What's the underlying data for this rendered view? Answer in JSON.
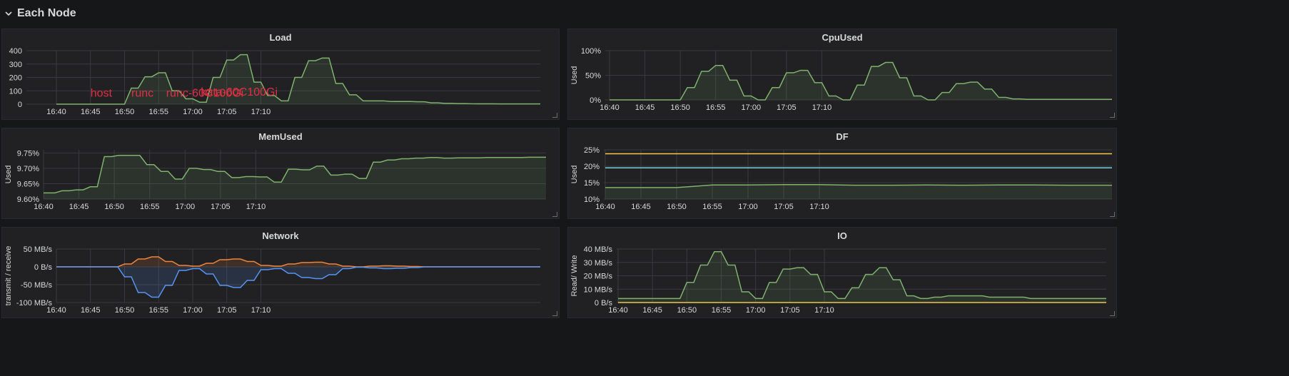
{
  "row": {
    "title": "Each Node"
  },
  "colors": {
    "green": "#7eb26d",
    "green_fill": "rgba(126,178,109,0.12)",
    "orange": "#ef843c",
    "blue": "#5794f2",
    "yellow": "#f2c94c",
    "cyan": "#6ed0e0",
    "annotation": "#e02f44",
    "grid": "#3a3a3e",
    "tick": "#d8d9da"
  },
  "panels": [
    {
      "id": "load",
      "title": "Load",
      "ylabel": "",
      "xticks": [
        "16:40",
        "16:45",
        "16:50",
        "16:55",
        "17:00",
        "17:05",
        "17:10"
      ],
      "yticks": [
        {
          "v": 0,
          "l": "0"
        },
        {
          "v": 100,
          "l": "100"
        },
        {
          "v": 200,
          "l": "200"
        },
        {
          "v": 300,
          "l": "300"
        },
        {
          "v": 400,
          "l": "400"
        }
      ],
      "ylim": [
        0,
        400
      ],
      "annotations": [
        {
          "t": 16.75,
          "v": 55,
          "text": "host"
        },
        {
          "t": 16.85,
          "v": 55,
          "text": "runc"
        },
        {
          "t": 16.935,
          "v": 55,
          "text": "runc-60C100Gi"
        },
        {
          "t": 17.02,
          "v": 65,
          "text": "kata-60C100Gi"
        }
      ]
    },
    {
      "id": "cpu",
      "title": "CpuUsed",
      "ylabel": "Used",
      "xticks": [
        "16:40",
        "16:45",
        "16:50",
        "16:55",
        "17:00",
        "17:05",
        "17:10"
      ],
      "yticks": [
        {
          "v": 0,
          "l": "0%"
        },
        {
          "v": 50,
          "l": "50%"
        },
        {
          "v": 100,
          "l": "100%"
        }
      ],
      "ylim": [
        0,
        100
      ]
    },
    {
      "id": "mem",
      "title": "MemUsed",
      "ylabel": "Used",
      "xticks": [
        "16:40",
        "16:45",
        "16:50",
        "16:55",
        "17:00",
        "17:05",
        "17:10"
      ],
      "yticks": [
        {
          "v": 9.6,
          "l": "9.60%"
        },
        {
          "v": 9.65,
          "l": "9.65%"
        },
        {
          "v": 9.7,
          "l": "9.70%"
        },
        {
          "v": 9.75,
          "l": "9.75%"
        }
      ],
      "ylim": [
        9.6,
        9.76
      ]
    },
    {
      "id": "df",
      "title": "DF",
      "ylabel": "Used",
      "xticks": [
        "16:40",
        "16:45",
        "16:50",
        "16:55",
        "17:00",
        "17:05",
        "17:10"
      ],
      "yticks": [
        {
          "v": 10,
          "l": "10%"
        },
        {
          "v": 15,
          "l": "15%"
        },
        {
          "v": 20,
          "l": "20%"
        },
        {
          "v": 25,
          "l": "25%"
        }
      ],
      "ylim": [
        10,
        25
      ]
    },
    {
      "id": "net",
      "title": "Network",
      "ylabel": "transmit / receive",
      "xticks": [
        "16:40",
        "16:45",
        "16:50",
        "16:55",
        "17:00",
        "17:05",
        "17:10"
      ],
      "yticks": [
        {
          "v": -100,
          "l": "-100 MB/s"
        },
        {
          "v": -50,
          "l": "-50 MB/s"
        },
        {
          "v": 0,
          "l": "0 B/s"
        },
        {
          "v": 50,
          "l": "50 MB/s"
        }
      ],
      "ylim": [
        -100,
        50
      ]
    },
    {
      "id": "io",
      "title": "IO",
      "ylabel": "Read/ Write",
      "xticks": [
        "16:40",
        "16:45",
        "16:50",
        "16:55",
        "17:00",
        "17:05",
        "17:10"
      ],
      "yticks": [
        {
          "v": 0,
          "l": "0 B/s"
        },
        {
          "v": 10,
          "l": "10 MB/s"
        },
        {
          "v": 20,
          "l": "20 MB/s"
        },
        {
          "v": 30,
          "l": "30 MB/s"
        },
        {
          "v": 40,
          "l": "40 MB/s"
        }
      ],
      "ylim": [
        0,
        40
      ]
    }
  ],
  "chart_data": [
    {
      "type": "area",
      "title": "Load",
      "x_unit": "minutes since 16:40",
      "series": [
        {
          "color": "green",
          "x": [
            0,
            3,
            4,
            5,
            6,
            7,
            8,
            9,
            10,
            11,
            12,
            13,
            14,
            15,
            16,
            17,
            18,
            19,
            20,
            21,
            22,
            23,
            24,
            25,
            26,
            27,
            28,
            29,
            30,
            31,
            32,
            33,
            34,
            35,
            36,
            37,
            38,
            39,
            40,
            41,
            42,
            43,
            44,
            45,
            46,
            47,
            48,
            49,
            50,
            51,
            52,
            53,
            54,
            55,
            56,
            57,
            58,
            59,
            60,
            61,
            62,
            63,
            64,
            65,
            66,
            67,
            68,
            69,
            70,
            71
          ],
          "values": [
            0,
            0,
            0,
            0,
            0,
            0,
            0,
            0,
            0,
            120,
            120,
            205,
            205,
            235,
            235,
            100,
            100,
            40,
            40,
            15,
            15,
            200,
            200,
            330,
            330,
            370,
            370,
            165,
            165,
            65,
            65,
            25,
            25,
            200,
            200,
            325,
            325,
            345,
            345,
            155,
            155,
            70,
            70,
            25,
            25,
            25,
            25,
            20,
            20,
            20,
            20,
            18,
            18,
            10,
            10,
            6,
            6,
            4,
            4,
            3,
            3,
            3,
            3,
            2,
            2,
            2,
            2,
            2,
            2,
            2
          ]
        }
      ]
    },
    {
      "type": "area",
      "title": "CpuUsed",
      "ylabel": "Used",
      "series": [
        {
          "color": "green",
          "x": [
            0,
            1,
            2,
            3,
            4,
            5,
            6,
            7,
            8,
            9,
            10,
            11,
            12,
            13,
            14,
            15,
            16,
            17,
            18,
            19,
            20,
            21,
            22,
            23,
            24,
            25,
            26,
            27,
            28,
            29,
            30,
            31,
            32,
            33,
            34,
            35,
            36,
            37,
            38,
            39,
            40,
            41,
            42,
            43,
            44,
            45,
            46,
            47,
            48,
            49,
            50,
            51,
            52,
            53,
            54,
            55,
            56,
            57,
            58,
            59,
            60,
            61,
            62,
            63,
            64,
            65,
            66,
            67,
            68,
            69,
            70,
            71
          ],
          "values": [
            0,
            0,
            0,
            0,
            0,
            0,
            0,
            0,
            0,
            0,
            0,
            25,
            25,
            58,
            58,
            70,
            70,
            40,
            40,
            8,
            8,
            0,
            0,
            25,
            25,
            55,
            55,
            60,
            60,
            35,
            35,
            8,
            8,
            0,
            0,
            30,
            30,
            68,
            68,
            76,
            76,
            45,
            45,
            8,
            8,
            0,
            0,
            15,
            15,
            33,
            33,
            36,
            36,
            22,
            22,
            5,
            5,
            2,
            2,
            1,
            1,
            1,
            1,
            1,
            1,
            1,
            1,
            1,
            1,
            1,
            1,
            1
          ]
        }
      ]
    },
    {
      "type": "area",
      "title": "MemUsed",
      "ylabel": "Used",
      "series": [
        {
          "color": "green",
          "x": [
            0,
            0.6,
            1.6,
            2.6,
            3.6,
            4.6,
            5.6,
            6.6,
            7.6,
            8.6,
            9.6,
            10.6,
            11.6,
            12.6,
            13.6,
            14.6,
            15.6,
            16.6,
            17.6,
            18.6,
            19.6,
            20.6,
            21.6,
            22.6,
            23.6,
            24.6,
            25.6,
            26.6,
            27.6,
            28.6,
            29.6,
            30.6,
            31.6,
            32.6,
            33.6,
            34.6,
            35.6,
            36.6,
            37.6,
            38.6,
            39.6,
            40.6,
            41.6,
            42.6,
            43.6,
            44.6,
            45.6,
            46.6,
            47.6,
            48.6,
            49.6,
            50.6,
            51.6,
            52.6,
            53.6,
            54.6,
            55.6,
            56.6,
            57.6,
            58.6,
            59.6,
            60.6,
            61.6,
            62.6,
            63.6,
            64.6,
            65.6,
            66.6,
            67.6,
            68.6,
            69.6,
            70.6,
            71
          ],
          "values": [
            9.62,
            9.62,
            9.62,
            9.627,
            9.627,
            9.63,
            9.63,
            9.64,
            9.64,
            9.738,
            9.738,
            9.742,
            9.742,
            9.742,
            9.742,
            9.712,
            9.712,
            9.69,
            9.69,
            9.665,
            9.665,
            9.7,
            9.7,
            9.696,
            9.696,
            9.69,
            9.69,
            9.67,
            9.67,
            9.673,
            9.673,
            9.672,
            9.672,
            9.655,
            9.655,
            9.697,
            9.697,
            9.695,
            9.695,
            9.707,
            9.707,
            9.678,
            9.678,
            9.681,
            9.681,
            9.667,
            9.667,
            9.72,
            9.72,
            9.727,
            9.727,
            9.731,
            9.731,
            9.733,
            9.733,
            9.735,
            9.735,
            9.733,
            9.733,
            9.734,
            9.734,
            9.734,
            9.734,
            9.735,
            9.735,
            9.735,
            9.735,
            9.735,
            9.735,
            9.736,
            9.736,
            9.736,
            9.736
          ]
        }
      ]
    },
    {
      "type": "line",
      "title": "DF",
      "ylabel": "Used",
      "series": [
        {
          "color": "yellow",
          "x": [
            0,
            71
          ],
          "values": [
            23.8,
            23.8
          ]
        },
        {
          "color": "cyan",
          "x": [
            0,
            71
          ],
          "values": [
            19.5,
            19.5
          ]
        },
        {
          "color": "green",
          "fill": true,
          "x": [
            0,
            10,
            12,
            15,
            20,
            25,
            30,
            35,
            40,
            45,
            50,
            55,
            60,
            65,
            71
          ],
          "values": [
            13.5,
            13.5,
            13.8,
            14.3,
            14.3,
            14.4,
            14.4,
            14.2,
            14.2,
            14.3,
            14.2,
            14.3,
            14.3,
            14.2,
            14.2
          ]
        }
      ]
    },
    {
      "type": "area",
      "title": "Network",
      "ylabel": "transmit / receive",
      "series": [
        {
          "color": "orange",
          "x": [
            0,
            9,
            10,
            11,
            12,
            13,
            14,
            15,
            16,
            17,
            18,
            19,
            20,
            21,
            22,
            23,
            24,
            25,
            26,
            27,
            28,
            29,
            30,
            31,
            32,
            33,
            34,
            35,
            36,
            37,
            38,
            39,
            40,
            41,
            42,
            43,
            44,
            45,
            46,
            47,
            48,
            49,
            50,
            51,
            52,
            53,
            54,
            55,
            56,
            71
          ],
          "values": [
            0,
            0,
            8,
            8,
            22,
            22,
            28,
            28,
            15,
            15,
            4,
            4,
            2,
            2,
            10,
            10,
            20,
            20,
            22,
            22,
            15,
            15,
            4,
            4,
            2,
            2,
            8,
            8,
            12,
            12,
            13,
            13,
            8,
            8,
            2,
            2,
            0,
            0,
            2,
            2,
            3,
            3,
            2,
            2,
            1,
            1,
            0,
            0,
            0,
            0
          ]
        },
        {
          "color": "blue",
          "x": [
            0,
            9,
            10,
            11,
            12,
            13,
            14,
            15,
            16,
            17,
            18,
            19,
            20,
            21,
            22,
            23,
            24,
            25,
            26,
            27,
            28,
            29,
            30,
            31,
            32,
            33,
            34,
            35,
            36,
            37,
            38,
            39,
            40,
            41,
            42,
            43,
            44,
            45,
            46,
            47,
            48,
            49,
            50,
            51,
            52,
            53,
            54,
            55,
            56,
            71
          ],
          "values": [
            0,
            0,
            -28,
            -28,
            -72,
            -72,
            -85,
            -85,
            -52,
            -52,
            -10,
            -10,
            -5,
            -5,
            -20,
            -20,
            -52,
            -52,
            -58,
            -58,
            -38,
            -38,
            -8,
            -8,
            -5,
            -5,
            -18,
            -18,
            -30,
            -30,
            -33,
            -33,
            -22,
            -22,
            -5,
            -5,
            -1,
            -1,
            -3,
            -3,
            -5,
            -5,
            -4,
            -4,
            -2,
            -2,
            0,
            0,
            0,
            0
          ]
        }
      ]
    },
    {
      "type": "area",
      "title": "IO",
      "ylabel": "Read/ Write",
      "series": [
        {
          "color": "yellow",
          "x": [
            0,
            71
          ],
          "values": [
            0,
            0
          ]
        },
        {
          "color": "green",
          "x": [
            0,
            1,
            2,
            3,
            4,
            5,
            6,
            7,
            8,
            9,
            10,
            11,
            12,
            13,
            14,
            15,
            16,
            17,
            18,
            19,
            20,
            21,
            22,
            23,
            24,
            25,
            26,
            27,
            28,
            29,
            30,
            31,
            32,
            33,
            34,
            35,
            36,
            37,
            38,
            39,
            40,
            41,
            42,
            43,
            44,
            45,
            46,
            47,
            48,
            49,
            50,
            51,
            52,
            53,
            54,
            55,
            56,
            57,
            58,
            59,
            60,
            61,
            62,
            63,
            64,
            65,
            66,
            67,
            68,
            69,
            70,
            71
          ],
          "values": [
            3,
            3,
            3,
            3,
            3,
            3,
            3,
            3,
            3,
            3,
            15,
            15,
            28,
            28,
            38,
            38,
            28,
            28,
            8,
            8,
            3,
            3,
            15,
            15,
            25,
            25,
            26,
            26,
            21,
            21,
            8,
            8,
            3,
            3,
            11,
            11,
            21,
            21,
            26,
            26,
            17,
            17,
            5,
            5,
            3,
            3,
            4,
            4,
            5,
            5,
            5,
            5,
            5,
            5,
            4,
            4,
            4,
            4,
            4,
            4,
            3,
            3,
            3,
            3,
            3,
            3,
            3,
            3,
            3,
            3,
            3,
            3
          ]
        }
      ]
    }
  ]
}
